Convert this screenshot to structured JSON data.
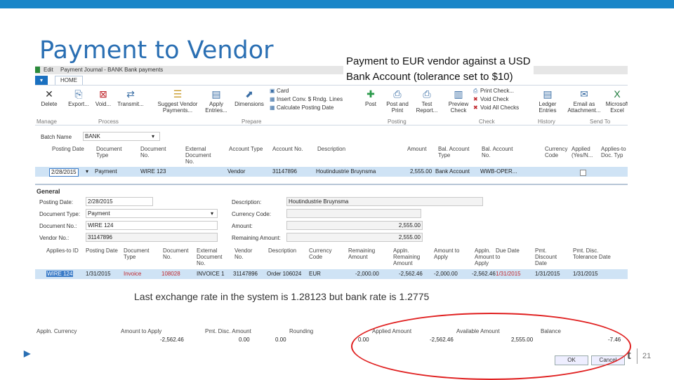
{
  "slide": {
    "title": "Payment to Vendor",
    "caption_line1": "Payment to EUR vendor against a USD",
    "caption_line2": "Bank Account (tolerance set to $10)",
    "note": "Last exchange rate in the system is 1.28123 but bank rate is 1.2775",
    "slide_number": "21",
    "accent_color": "#1a86c8",
    "annotation_color": "#e02020"
  },
  "window": {
    "menu_edit": "Edit",
    "breadcrumb": "Payment Journal - BANK Bank payments",
    "app_menu_icon": "dropdown-arrow-icon",
    "tab": "HOME"
  },
  "ribbon": {
    "buttons": [
      {
        "label": "Delete",
        "icon": "delete-x-icon"
      },
      {
        "label": "Export...",
        "icon": "export-icon"
      },
      {
        "label": "Void...",
        "icon": "void-icon"
      },
      {
        "label": "Transmit...",
        "icon": "transmit-icon"
      },
      {
        "label": "Suggest Vendor Payments...",
        "icon": "suggest-icon"
      },
      {
        "label": "Apply Entries...",
        "icon": "apply-icon"
      },
      {
        "label": "Dimensions",
        "icon": "dimensions-icon"
      },
      {
        "label": "Post",
        "icon": "post-icon"
      },
      {
        "label": "Post and Print",
        "icon": "post-print-icon"
      },
      {
        "label": "Test Report...",
        "icon": "test-report-icon"
      },
      {
        "label": "Preview Check",
        "icon": "preview-check-icon"
      },
      {
        "label": "Ledger Entries",
        "icon": "ledger-icon"
      },
      {
        "label": "Email as Attachment...",
        "icon": "email-icon"
      },
      {
        "label": "Microsoft Excel",
        "icon": "excel-icon"
      }
    ],
    "small": {
      "card": "Card",
      "insert_conv": "Insert Conv. $ Rndg. Lines",
      "calc_posting": "Calculate Posting Date",
      "print_check": "Print Check...",
      "void_check": "Void Check",
      "void_all": "Void All Checks"
    },
    "groups": {
      "manage": "Manage",
      "process": "Process",
      "prepare": "Prepare",
      "posting": "Posting",
      "check": "Check",
      "history": "History",
      "send_to": "Send To"
    }
  },
  "batch": {
    "label": "Batch Name",
    "value": "BANK"
  },
  "journal": {
    "headers": [
      "Posting Date",
      "Document Type",
      "Document No.",
      "External Document No.",
      "Account Type",
      "Account No.",
      "Description",
      "Amount",
      "Bal. Account Type",
      "Bal. Account No.",
      "Currency Code",
      "Applied (Yes/N...",
      "Applies-to Doc. Typ"
    ],
    "row": [
      "2/28/2015",
      "Payment",
      "WIRE 123",
      "",
      "Vendor",
      "31147896",
      "Houtindustrie Bruynsma",
      "2,555.00",
      "Bank Account",
      "WWB-OPER...",
      "",
      "",
      ""
    ]
  },
  "general": {
    "title": "General",
    "posting_date_label": "Posting Date:",
    "posting_date": "2/28/2015",
    "doc_type_label": "Document Type:",
    "doc_type": "Payment",
    "doc_no_label": "Document No.:",
    "doc_no": "WIRE 124",
    "vendor_no_label": "Vendor No.:",
    "vendor_no": "31147896",
    "description_label": "Description:",
    "description": "Houtindustrie Bruynsma",
    "currency_label": "Currency Code:",
    "currency": "",
    "amount_label": "Amount:",
    "amount": "2,555.00",
    "remaining_label": "Remaining Amount:",
    "remaining": "2,555.00"
  },
  "apply": {
    "headers": [
      "Applies-to ID",
      "Posting Date",
      "Document Type",
      "Document No.",
      "External Document No.",
      "Vendor No.",
      "Description",
      "Currency Code",
      "Remaining Amount",
      "Appln. Remaining Amount",
      "Amount to Apply",
      "Appln. Amount to Apply",
      "Due Date",
      "Pmt. Discount Date",
      "Pmt. Disc. Tolerance Date"
    ],
    "row": [
      "WIRE 124",
      "1/31/2015",
      "Invoice",
      "108028",
      "INVOICE 1",
      "31147896",
      "Order 106024",
      "EUR",
      "-2,000.00",
      "-2,562.46",
      "-2,000.00",
      "-2,562.46",
      "1/31/2015",
      "1/31/2015",
      "1/31/2015"
    ]
  },
  "footer": {
    "appln_currency_label": "Appln. Currency",
    "appln_currency": "",
    "amount_to_apply_label": "Amount to Apply",
    "amount_to_apply": "-2,562.46",
    "pmt_disc_label": "Pmt. Disc. Amount",
    "pmt_disc": "0.00",
    "rounding_label": "Rounding",
    "rounding": "0.00",
    "applied_amount_label": "Applied Amount",
    "applied_amount": "0.00",
    "applied_amount2": "-2,562.46",
    "available_amount_label": "Available Amount",
    "available_amount": "2,555.00",
    "balance_label": "Balance",
    "balance": "-7.46",
    "ok": "OK",
    "cancel": "Cancel"
  }
}
